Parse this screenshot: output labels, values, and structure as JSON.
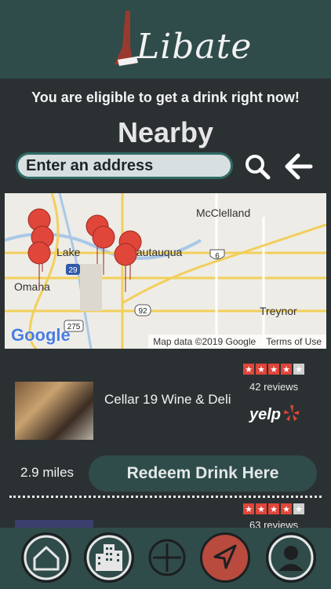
{
  "header": {
    "logo_text": "Libate"
  },
  "eligibility_message": "You are eligible to get a drink right now!",
  "page_title": "Nearby",
  "search": {
    "placeholder": "Enter an address"
  },
  "map": {
    "labels": [
      "McClelland",
      "Lake",
      "Chautauqua",
      "Omaha",
      "Treynor"
    ],
    "route_shields": [
      "29",
      "6",
      "92",
      "275"
    ],
    "attribution": "Google",
    "footer_data": "Map data ©2019 Google",
    "footer_terms": "Terms of Use",
    "pin_count": 6
  },
  "listings": [
    {
      "name": "Cellar 19 Wine & Deli",
      "rating": 4,
      "rating_max": 5,
      "reviews": "42 reviews",
      "source": "yelp",
      "distance": "2.9 miles",
      "action": "Redeem Drink Here"
    },
    {
      "rating": 4,
      "rating_max": 5,
      "reviews": "63 reviews"
    }
  ],
  "nav": {
    "items": [
      "home-icon",
      "building-icon",
      "add-icon",
      "navigate-icon",
      "profile-icon"
    ],
    "active": "navigate-icon",
    "active_color": "#b84a3e"
  },
  "colors": {
    "header": "#2f4c4a",
    "background": "#2b3133",
    "accent": "#e0463a"
  }
}
